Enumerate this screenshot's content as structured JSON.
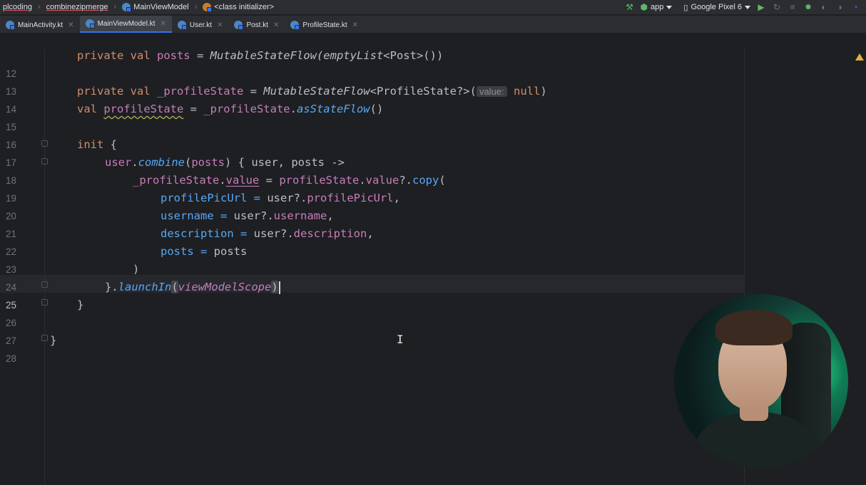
{
  "breadcrumbs": [
    "plcoding",
    "combinezipmerge",
    "MainViewModel",
    "<class initializer>"
  ],
  "toolbar": {
    "run_config": "app",
    "device": "Google Pixel 6"
  },
  "tabs": [
    {
      "label": "MainActivity.kt",
      "active": false
    },
    {
      "label": "MainViewModel.kt",
      "active": true
    },
    {
      "label": "User.kt",
      "active": false
    },
    {
      "label": "Post.kt",
      "active": false
    },
    {
      "label": "ProfileState.kt",
      "active": false
    }
  ],
  "editor": {
    "line_numbers": [
      "12",
      "13",
      "14",
      "15",
      "16",
      "17",
      "18",
      "19",
      "20",
      "21",
      "22",
      "23",
      "24",
      "25",
      "26",
      "27",
      "28"
    ],
    "lines": {
      "l12": {
        "kw": "private val ",
        "name": "posts",
        "eq": " = ",
        "call": "MutableStateFlow",
        "rest": "(emptyList<",
        "type": "Post",
        "end": ">())"
      },
      "l14": {
        "kw": "private val ",
        "name": "_profileState",
        "eq": " = ",
        "call": "MutableStateFlow",
        "lt": "<",
        "type": "ProfileState",
        "q": "?>(",
        "hint": "value:",
        "null": " null",
        "end": ")"
      },
      "l15": {
        "kw": "val ",
        "name": "profileState",
        "eq": " = ",
        "recv": "_profileState",
        "dot": ".",
        "call": "asStateFlow",
        "end": "()"
      },
      "l17": {
        "kw": "init",
        "end": " {"
      },
      "l18": {
        "recv": "user",
        "dot": ".",
        "call": "combine",
        "open": "(",
        "arg": "posts",
        "rest": ") { user, posts ->"
      },
      "l19": {
        "recv": "_profileState",
        "dot": ".",
        "prop": "value",
        "eq": " = ",
        "recv2": "profileState",
        "dot2": ".",
        "prop2": "value",
        "rest": "?.",
        "call": "copy",
        "end": "("
      },
      "l20": {
        "param": "profilePicUrl",
        "eq": " = ",
        "val": "user?.",
        "prop": "profilePicUrl",
        "end": ","
      },
      "l21": {
        "param": "username",
        "eq": " = ",
        "val": "user?.",
        "prop": "username",
        "end": ","
      },
      "l22": {
        "param": "description",
        "eq": " = ",
        "val": "user?.",
        "prop": "description",
        "end": ","
      },
      "l23": {
        "param": "posts",
        "eq": " = ",
        "val": "posts"
      },
      "l24": {
        "text": ")"
      },
      "l25": {
        "pre": "}.",
        "call": "launchIn",
        "open": "(",
        "arg": "viewModelScope",
        "close": ")"
      },
      "l26": {
        "text": "}"
      },
      "l28": {
        "text": "}"
      }
    }
  }
}
